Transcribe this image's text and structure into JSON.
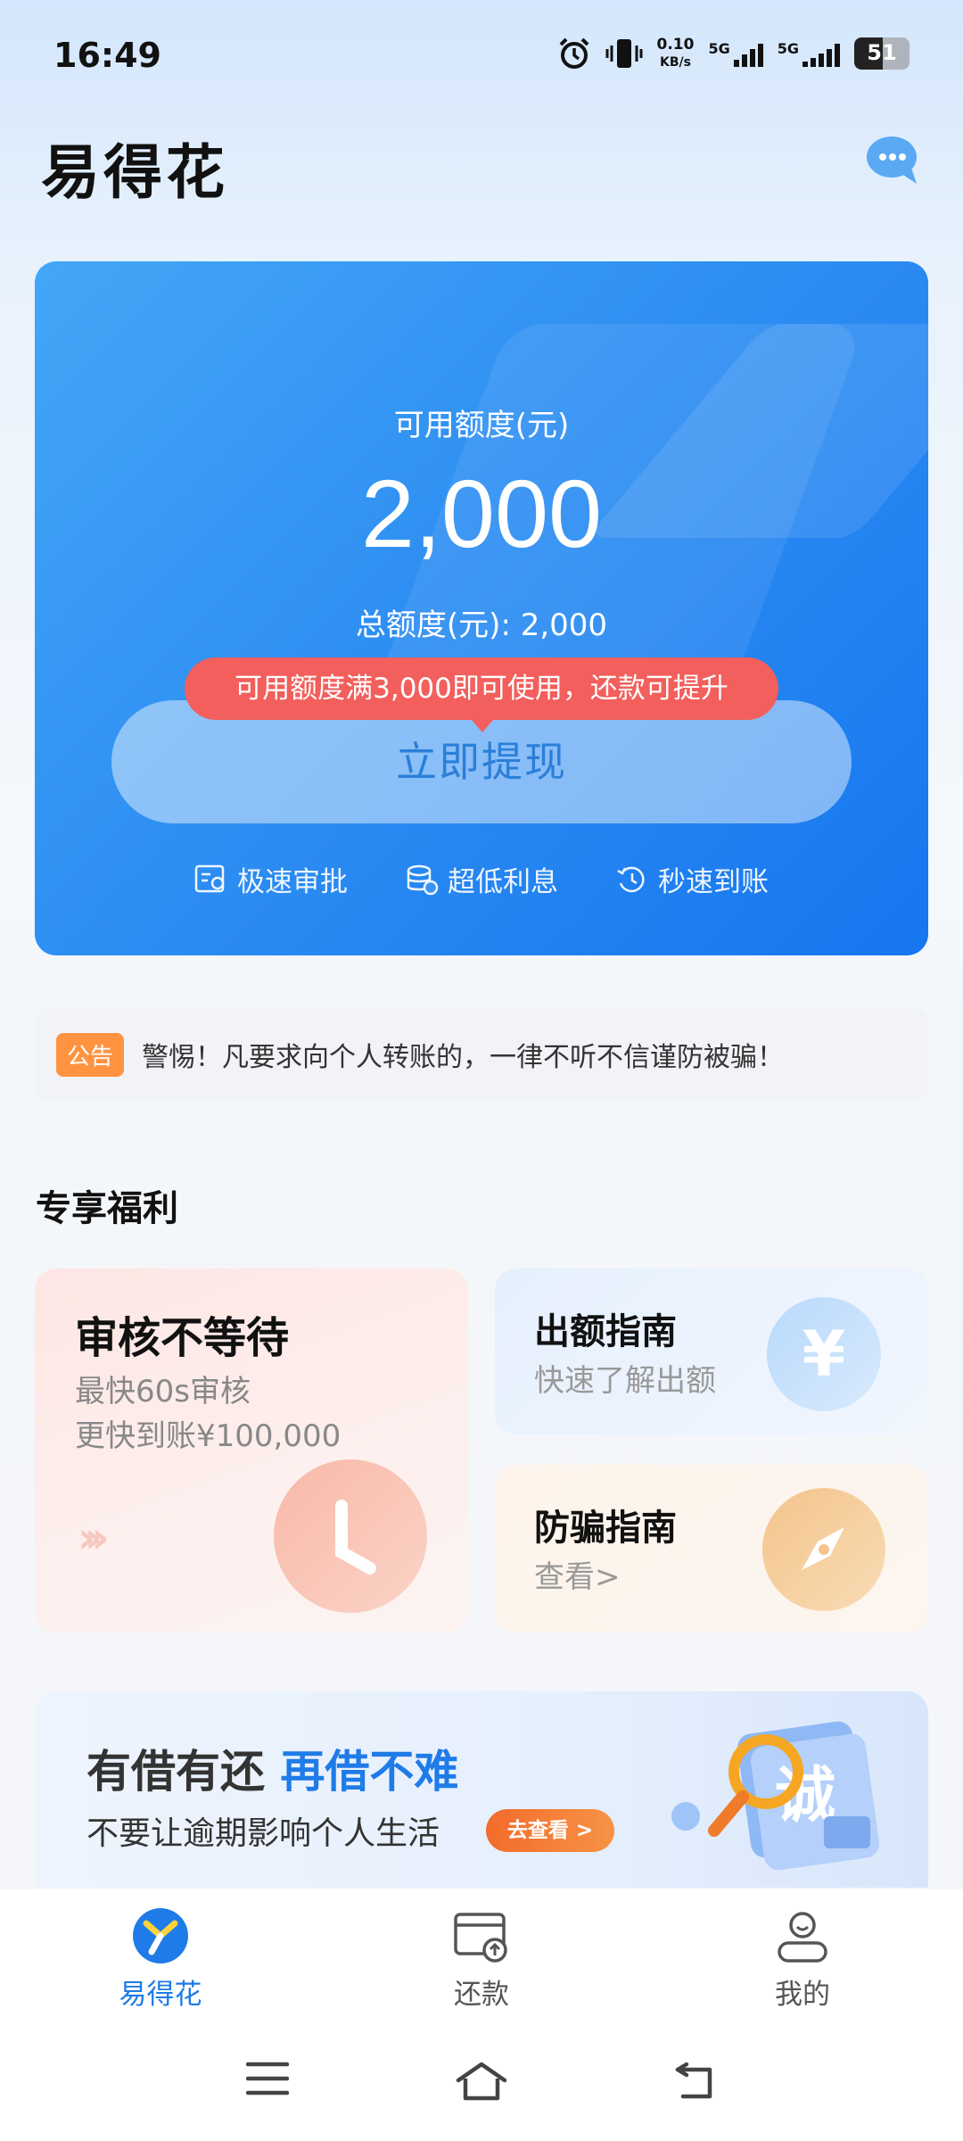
{
  "status_bar": {
    "time": "16:49",
    "speed_value": "0.10",
    "speed_unit": "KB/s",
    "net1": "5G",
    "net2": "5G",
    "battery": "51"
  },
  "header": {
    "title": "易得花",
    "chat_icon": "customer-service-chat-icon"
  },
  "credit": {
    "available_label": "可用额度(元)",
    "available_amount": "2,000",
    "total_label": "总额度(元): 2,000",
    "tip": "可用额度满3,000即可使用，还款可提升",
    "withdraw_label": "立即提现",
    "features": [
      "极速审批",
      "超低利息",
      "秒速到账"
    ]
  },
  "notice": {
    "tag": "公告",
    "text": "警惕！凡要求向个人转账的，一律不听不信谨防被骗！"
  },
  "benefits": {
    "section_title": "专享福利",
    "review": {
      "title": "审核不等待",
      "line1": "最快60s审核",
      "line2": "更快到账¥100,000"
    },
    "guide": {
      "title": "出额指南",
      "subtitle": "快速了解出额",
      "icon_text": "¥"
    },
    "fraud": {
      "title": "防骗指南",
      "subtitle": "查看>"
    }
  },
  "banner": {
    "heading": "有借有还",
    "heading_highlight": "再借不难",
    "subtitle": "不要让逾期影响个人生活",
    "button": "去查看 >",
    "art_text": "诚"
  },
  "bottom_nav": {
    "items": [
      {
        "label": "易得花",
        "icon": "home-logo-icon",
        "active": true
      },
      {
        "label": "还款",
        "icon": "repay-icon",
        "active": false
      },
      {
        "label": "我的",
        "icon": "profile-icon",
        "active": false
      }
    ]
  },
  "colors": {
    "primary": "#1f7be8",
    "tip": "#f25f5c",
    "notice_tag": "#ff9340"
  }
}
